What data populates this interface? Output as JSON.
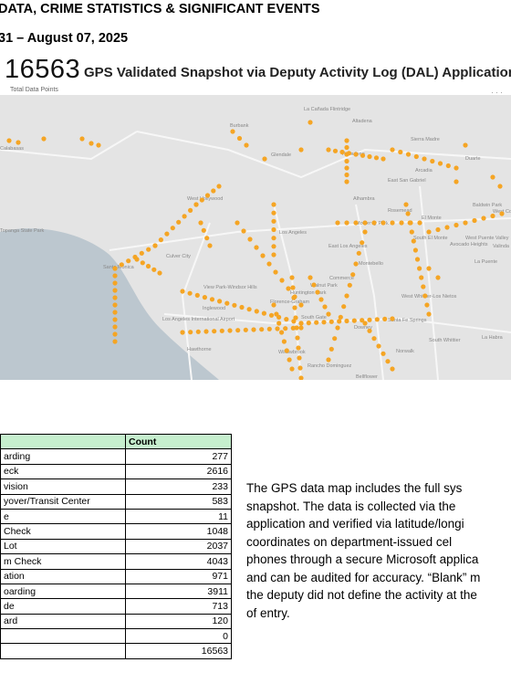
{
  "header": {
    "line1": "DATA, CRIME STATISTICS & SIGNIFICANT EVENTS",
    "line2": "31 – August 07, 2025"
  },
  "summary": {
    "total_value": "16563",
    "total_label": "Total Data Points",
    "title": "GPS Validated Snapshot via Deputy Activity Log (DAL) Application"
  },
  "map": {
    "place_labels": [
      "La Cañada Flintridge",
      "Altadena",
      "Sierra Madre",
      "Burbank",
      "Glendale",
      "Pasadena",
      "Arcadia",
      "Duarte",
      "East San Gabriel",
      "Alhambra",
      "Rosemead",
      "El Monte",
      "Baldwin Park",
      "West Covina",
      "Monterey Park",
      "South El Monte",
      "West Puente Valley",
      "Avocado Heights",
      "Valinda",
      "La Puente",
      "West Hollywood",
      "Los Angeles",
      "East Los Angeles",
      "Montebello",
      "Culver City",
      "View Park-Windsor Hills",
      "Commerce",
      "Walnut Park",
      "Huntington Park",
      "West Whittier-Los Nietos",
      "Florence-Graham",
      "Inglewood",
      "South Gate",
      "Downey",
      "Santa Fe Springs",
      "Los Angeles International Airport",
      "Hawthorne",
      "Norwalk",
      "South Whittier",
      "La Habra",
      "Willowbrook",
      "Rancho Dominguez",
      "Santa Monica",
      "Topanga State Park",
      "Calabasas",
      "Bellflower"
    ]
  },
  "table": {
    "headers": [
      "",
      "Count"
    ],
    "rows": [
      {
        "category": "arding",
        "count": "277"
      },
      {
        "category": "eck",
        "count": "2616"
      },
      {
        "category": "vision",
        "count": "233"
      },
      {
        "category": "yover/Transit Center",
        "count": "583"
      },
      {
        "category": "e",
        "count": "11"
      },
      {
        "category": "Check",
        "count": "1048"
      },
      {
        "category": "Lot",
        "count": "2037"
      },
      {
        "category": "m Check",
        "count": "4043"
      },
      {
        "category": "ation",
        "count": "971"
      },
      {
        "category": "oarding",
        "count": "3911"
      },
      {
        "category": "de",
        "count": "713"
      },
      {
        "category": "ard",
        "count": "120"
      },
      {
        "category": "",
        "count": "0"
      },
      {
        "category": "",
        "count": "16563"
      }
    ]
  },
  "description": {
    "lines": [
      "The GPS data map includes the full sys",
      "snapshot. The data is collected via the",
      "application and verified via latitude/longi",
      "coordinates on department-issued cel",
      "phones through a secure Microsoft applica",
      "and can be audited for accuracy. “Blank” m",
      "the deputy did not define the activity at the",
      "of entry."
    ]
  },
  "colors": {
    "dot": "#f5a524",
    "header_fill": "#c6efce",
    "map_land": "#e4e4e4",
    "map_water": "#bcc7cf"
  }
}
